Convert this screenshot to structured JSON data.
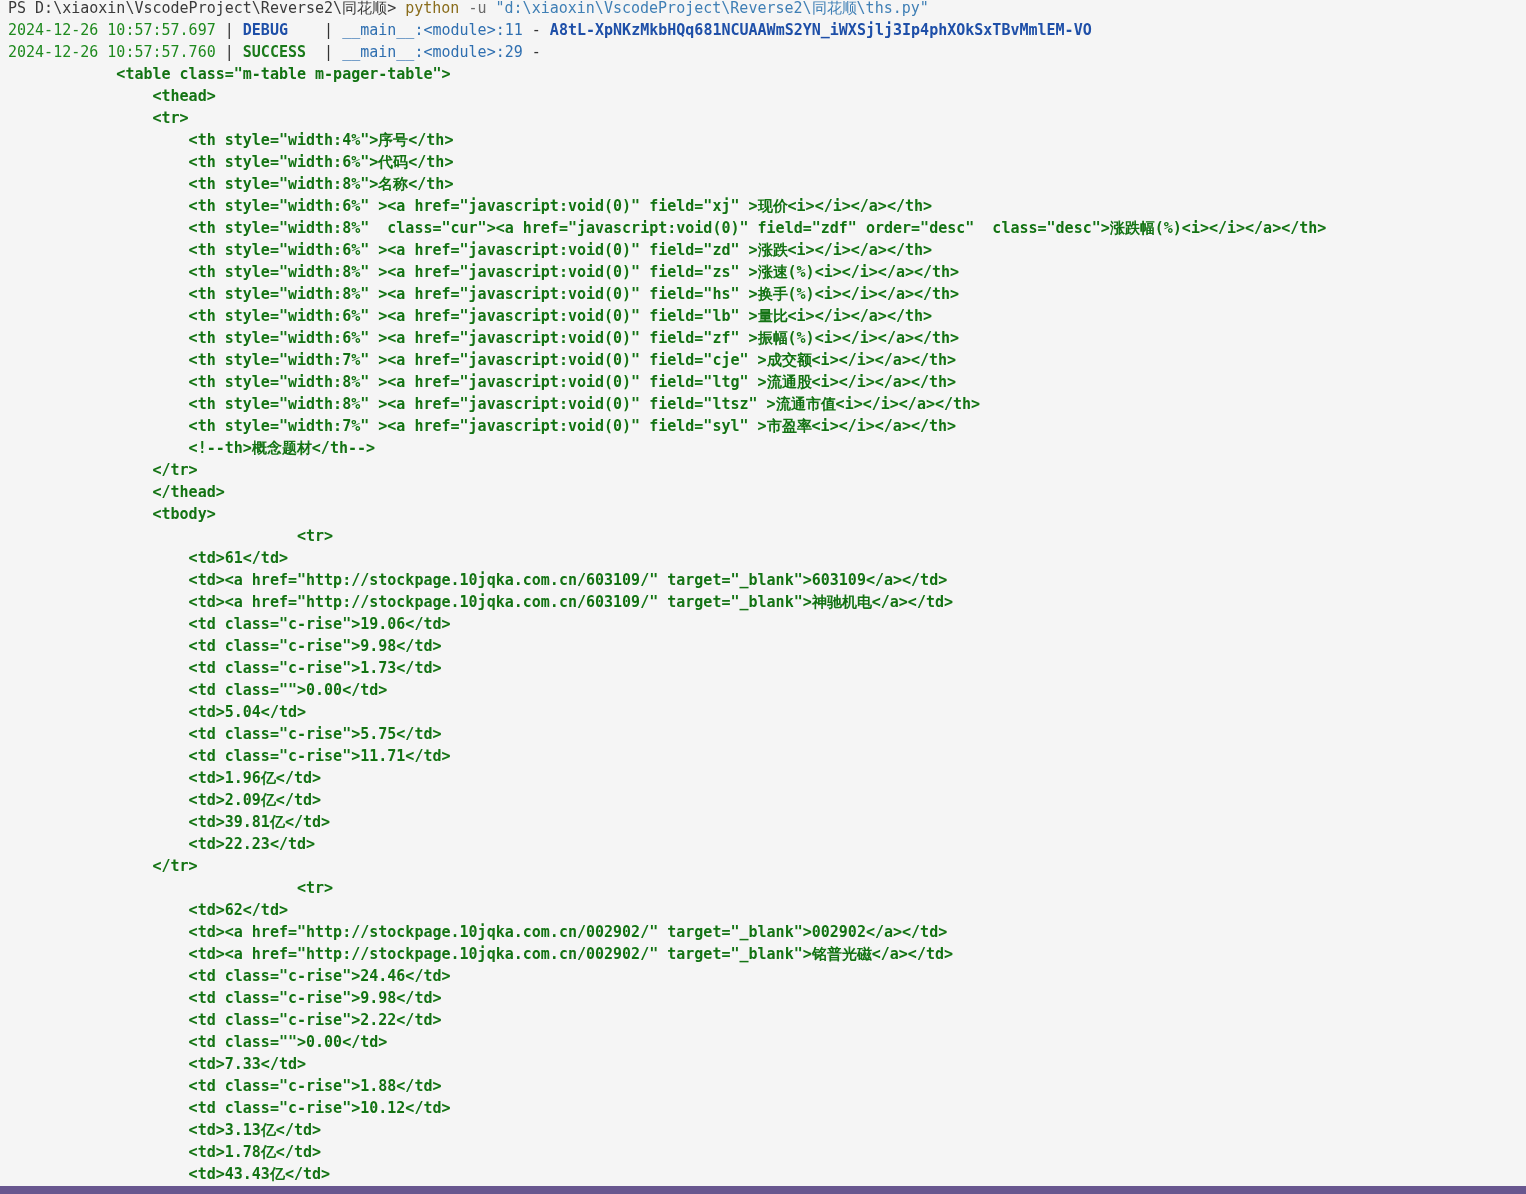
{
  "terminal": {
    "lines": [
      {
        "kind": "prompt",
        "segments": [
          {
            "kind": "path",
            "text": "PS D:\\xiaoxin\\VscodeProject\\Reverse2\\同花顺>"
          },
          {
            "kind": "command",
            "text": "python"
          },
          {
            "kind": "flag",
            "text": "-u"
          },
          {
            "kind": "string",
            "text": "\"d:\\xiaoxin\\VscodeProject\\Reverse2\\同花顺\\ths.py\""
          }
        ]
      },
      {
        "kind": "log",
        "timestamp": "2024-12-26 10:57:57.697",
        "separator": "|",
        "level": "DEBUG",
        "color": "#1e4fa8",
        "separator_2": "|",
        "source": "__main__:<module>:11",
        "dash": "-",
        "message": "A8tL-XpNKzMkbHQq681NCUAAWmS2YN_iWXSjlj3Ip4phXOkSxTBvMmlEM-VO"
      },
      {
        "kind": "log",
        "timestamp": "2024-12-26 10:57:57.760",
        "separator": "|",
        "level": "SUCCESS",
        "color": "#1b7a1b",
        "separator_2": "|",
        "source": "__main__:<module>:29",
        "dash": "-"
      },
      {
        "kind": "html",
        "text": "            <table class=\"m-table m-pager-table\">"
      },
      {
        "kind": "html",
        "text": "                <thead>"
      },
      {
        "kind": "html",
        "text": "                <tr>"
      },
      {
        "kind": "html",
        "text": "                    <th style=\"width:4%\">序号</th>"
      },
      {
        "kind": "html",
        "text": "                    <th style=\"width:6%\">代码</th>"
      },
      {
        "kind": "html",
        "text": "                    <th style=\"width:8%\">名称</th>"
      },
      {
        "kind": "html",
        "text": "                    <th style=\"width:6%\" ><a href=\"javascript:void(0)\" field=\"xj\" >现价<i></i></a></th>"
      },
      {
        "kind": "html",
        "text": "                    <th style=\"width:8%\"  class=\"cur\"><a href=\"javascript:void(0)\" field=\"zdf\" order=\"desc\"  class=\"desc\">涨跌幅(%)<i></i></a></th>"
      },
      {
        "kind": "html",
        "text": "                    <th style=\"width:6%\" ><a href=\"javascript:void(0)\" field=\"zd\" >涨跌<i></i></a></th>"
      },
      {
        "kind": "html",
        "text": "                    <th style=\"width:8%\" ><a href=\"javascript:void(0)\" field=\"zs\" >涨速(%)<i></i></a></th>"
      },
      {
        "kind": "html",
        "text": "                    <th style=\"width:8%\" ><a href=\"javascript:void(0)\" field=\"hs\" >换手(%)<i></i></a></th>"
      },
      {
        "kind": "html",
        "text": "                    <th style=\"width:6%\" ><a href=\"javascript:void(0)\" field=\"lb\" >量比<i></i></a></th>"
      },
      {
        "kind": "html",
        "text": "                    <th style=\"width:6%\" ><a href=\"javascript:void(0)\" field=\"zf\" >振幅(%)<i></i></a></th>"
      },
      {
        "kind": "html",
        "text": "                    <th style=\"width:7%\" ><a href=\"javascript:void(0)\" field=\"cje\" >成交额<i></i></a></th>"
      },
      {
        "kind": "html",
        "text": "                    <th style=\"width:8%\" ><a href=\"javascript:void(0)\" field=\"ltg\" >流通股<i></i></a></th>"
      },
      {
        "kind": "html",
        "text": "                    <th style=\"width:8%\" ><a href=\"javascript:void(0)\" field=\"ltsz\" >流通市值<i></i></a></th>"
      },
      {
        "kind": "html",
        "text": "                    <th style=\"width:7%\" ><a href=\"javascript:void(0)\" field=\"syl\" >市盈率<i></i></a></th>"
      },
      {
        "kind": "html",
        "text": "                    <!--th>概念题材</th-->"
      },
      {
        "kind": "html",
        "text": "                </tr>"
      },
      {
        "kind": "html",
        "text": "                </thead>"
      },
      {
        "kind": "html",
        "text": "                <tbody>"
      },
      {
        "kind": "html",
        "text": "                                <tr>"
      },
      {
        "kind": "html",
        "text": "                    <td>61</td>"
      },
      {
        "kind": "html",
        "text": "                    <td><a href=\"http://stockpage.10jqka.com.cn/603109/\" target=\"_blank\">603109</a></td>"
      },
      {
        "kind": "html",
        "text": "                    <td><a href=\"http://stockpage.10jqka.com.cn/603109/\" target=\"_blank\">神驰机电</a></td>"
      },
      {
        "kind": "html",
        "text": "                    <td class=\"c-rise\">19.06</td>"
      },
      {
        "kind": "html",
        "text": "                    <td class=\"c-rise\">9.98</td>"
      },
      {
        "kind": "html",
        "text": "                    <td class=\"c-rise\">1.73</td>"
      },
      {
        "kind": "html",
        "text": "                    <td class=\"\">0.00</td>"
      },
      {
        "kind": "html",
        "text": "                    <td>5.04</td>"
      },
      {
        "kind": "html",
        "text": "                    <td class=\"c-rise\">5.75</td>"
      },
      {
        "kind": "html",
        "text": "                    <td class=\"c-rise\">11.71</td>"
      },
      {
        "kind": "html",
        "text": "                    <td>1.96亿</td>"
      },
      {
        "kind": "html",
        "text": "                    <td>2.09亿</td>"
      },
      {
        "kind": "html",
        "text": "                    <td>39.81亿</td>"
      },
      {
        "kind": "html",
        "text": "                    <td>22.23</td>"
      },
      {
        "kind": "html",
        "text": "                </tr>"
      },
      {
        "kind": "html",
        "text": "                                <tr>"
      },
      {
        "kind": "html",
        "text": "                    <td>62</td>"
      },
      {
        "kind": "html",
        "text": "                    <td><a href=\"http://stockpage.10jqka.com.cn/002902/\" target=\"_blank\">002902</a></td>"
      },
      {
        "kind": "html",
        "text": "                    <td><a href=\"http://stockpage.10jqka.com.cn/002902/\" target=\"_blank\">铭普光磁</a></td>"
      },
      {
        "kind": "html",
        "text": "                    <td class=\"c-rise\">24.46</td>"
      },
      {
        "kind": "html",
        "text": "                    <td class=\"c-rise\">9.98</td>"
      },
      {
        "kind": "html",
        "text": "                    <td class=\"c-rise\">2.22</td>"
      },
      {
        "kind": "html",
        "text": "                    <td class=\"\">0.00</td>"
      },
      {
        "kind": "html",
        "text": "                    <td>7.33</td>"
      },
      {
        "kind": "html",
        "text": "                    <td class=\"c-rise\">1.88</td>"
      },
      {
        "kind": "html",
        "text": "                    <td class=\"c-rise\">10.12</td>"
      },
      {
        "kind": "html",
        "text": "                    <td>3.13亿</td>"
      },
      {
        "kind": "html",
        "text": "                    <td>1.78亿</td>"
      },
      {
        "kind": "html",
        "text": "                    <td>43.43亿</td>"
      }
    ]
  }
}
